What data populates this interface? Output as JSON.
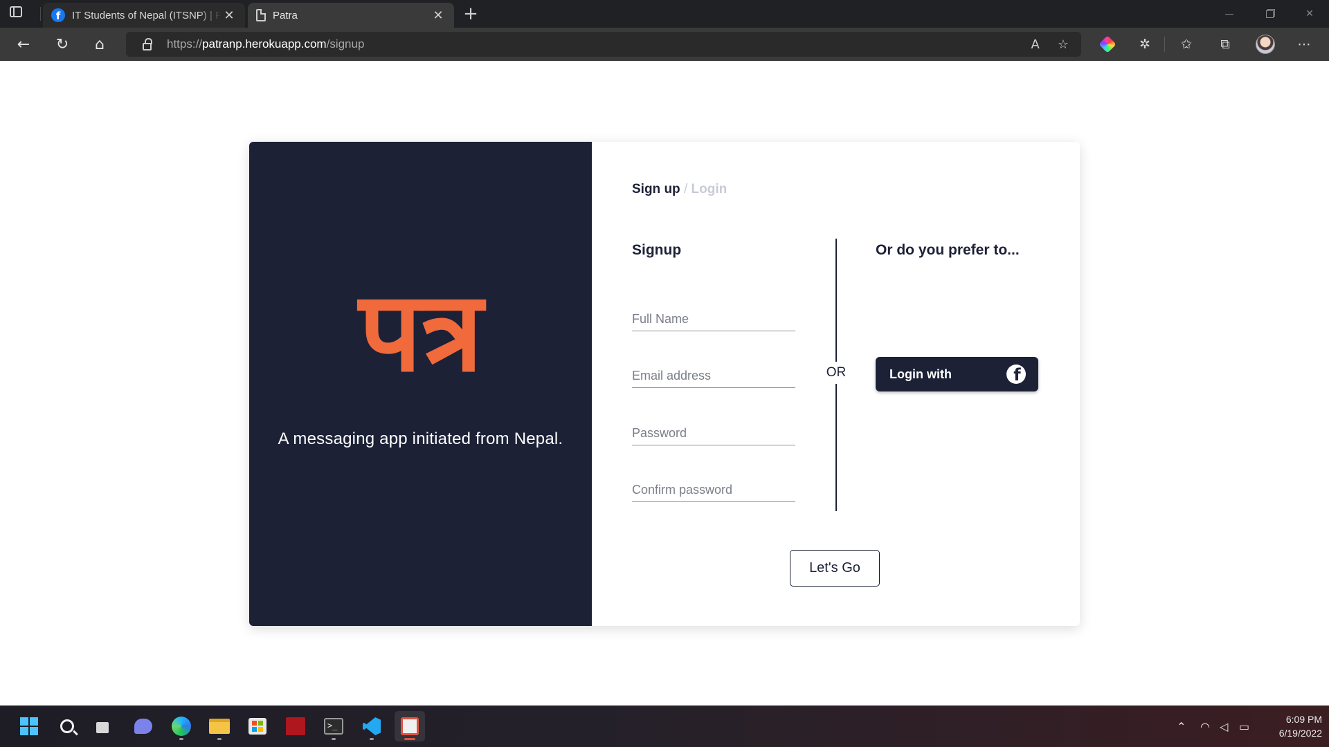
{
  "browser": {
    "tabs": [
      {
        "title": "IT Students of Nepal (ITSNP) | Facebook",
        "favicon": "facebook-icon",
        "active": false
      },
      {
        "title": "Patra",
        "favicon": "page-icon",
        "active": true
      }
    ],
    "url": {
      "scheme": "https://",
      "host": "patranp.herokuapp.com",
      "path": "/signup"
    }
  },
  "hero": {
    "logo_text": "पत्र",
    "tagline": "A messaging app initiated from Nepal.",
    "background": "#1c2136",
    "logo_color": "#f06a3c"
  },
  "form": {
    "breadcrumb": {
      "active": "Sign up",
      "separator": "/",
      "inactive": "Login"
    },
    "title": "Signup",
    "fields": [
      {
        "placeholder": "Full Name",
        "value": ""
      },
      {
        "placeholder": "Email address",
        "value": ""
      },
      {
        "placeholder": "Password",
        "value": ""
      },
      {
        "placeholder": "Confirm password",
        "value": ""
      }
    ],
    "divider_label": "OR",
    "alt_title": "Or do you prefer to...",
    "facebook_button": "Login with",
    "submit": "Let's Go"
  },
  "taskbar": {
    "time": "6:09 PM",
    "date": "6/19/2022",
    "apps": [
      "start-icon",
      "search-icon",
      "task-view-icon",
      "chat-icon",
      "edge-icon",
      "file-explorer-icon",
      "store-icon",
      "red-app-icon",
      "terminal-icon",
      "vscode-icon",
      "snipping-tool-icon"
    ]
  }
}
